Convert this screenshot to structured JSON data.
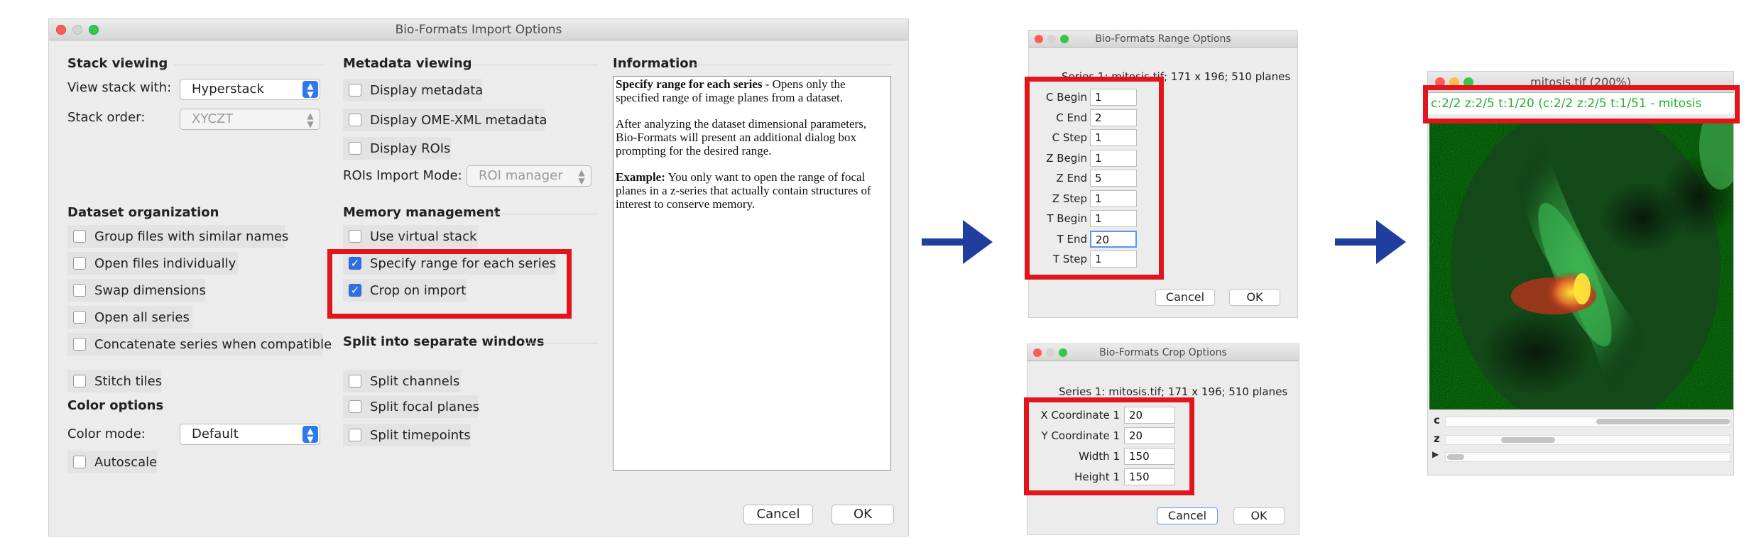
{
  "import_dialog": {
    "title": "Bio-Formats Import Options",
    "stack_viewing": {
      "heading": "Stack viewing",
      "view_stack_label": "View stack with:",
      "view_stack_value": "Hyperstack",
      "stack_order_label": "Stack order:",
      "stack_order_value": "XYCZT"
    },
    "dataset_org": {
      "heading": "Dataset organization",
      "items": [
        {
          "label": "Group files with similar names",
          "checked": false
        },
        {
          "label": "Open files individually",
          "checked": false
        },
        {
          "label": "Swap dimensions",
          "checked": false
        },
        {
          "label": "Open all series",
          "checked": false
        },
        {
          "label": "Concatenate series when compatible",
          "checked": false
        },
        {
          "label": "Stitch tiles",
          "checked": false
        }
      ]
    },
    "color_options": {
      "heading": "Color options",
      "color_mode_label": "Color mode:",
      "color_mode_value": "Default",
      "autoscale_label": "Autoscale"
    },
    "metadata_viewing": {
      "heading": "Metadata viewing",
      "items": [
        {
          "label": "Display metadata",
          "checked": false
        },
        {
          "label": "Display OME-XML metadata",
          "checked": false
        },
        {
          "label": "Display ROIs",
          "checked": false
        }
      ],
      "rois_mode_label": "ROIs Import Mode:",
      "rois_mode_value": "ROI manager"
    },
    "memory_management": {
      "heading": "Memory management",
      "items": [
        {
          "label": "Use virtual stack",
          "checked": false
        },
        {
          "label": "Specify range for each series",
          "checked": true
        },
        {
          "label": "Crop on import",
          "checked": true
        }
      ]
    },
    "split": {
      "heading": "Split into separate windows",
      "items": [
        {
          "label": "Split channels",
          "checked": false
        },
        {
          "label": "Split focal planes",
          "checked": false
        },
        {
          "label": "Split timepoints",
          "checked": false
        }
      ]
    },
    "information": {
      "heading": "Information",
      "p1_bold": "Specify range for each series",
      "p1_rest": " - Opens only the specified range of image planes from a dataset.",
      "p2": "After analyzing the dataset dimensional parameters, Bio-Formats will present an additional dialog box prompting for the desired range.",
      "p3_bold": "Example:",
      "p3_rest": " You only want to open the range of focal planes in a z-series that actually contain structures of interest to conserve memory."
    },
    "cancel_label": "Cancel",
    "ok_label": "OK"
  },
  "range_dialog": {
    "title": "Bio-Formats Range Options",
    "series_info": "Series 1: mitosis.tif; 171 x 196; 510 planes",
    "fields": [
      {
        "label": "C Begin",
        "value": "1"
      },
      {
        "label": "C End",
        "value": "2"
      },
      {
        "label": "C Step",
        "value": "1"
      },
      {
        "label": "Z Begin",
        "value": "1"
      },
      {
        "label": "Z End",
        "value": "5"
      },
      {
        "label": "Z Step",
        "value": "1"
      },
      {
        "label": "T Begin",
        "value": "1"
      },
      {
        "label": "T End",
        "value": "20"
      },
      {
        "label": "T Step",
        "value": "1"
      }
    ],
    "cancel_label": "Cancel",
    "ok_label": "OK"
  },
  "crop_dialog": {
    "title": "Bio-Formats Crop Options",
    "series_info": "Series 1: mitosis.tif; 171 x 196; 510 planes",
    "fields": [
      {
        "label": "X Coordinate 1",
        "value": "20"
      },
      {
        "label": "Y Coordinate 1",
        "value": "20"
      },
      {
        "label": "Width 1",
        "value": "150"
      },
      {
        "label": "Height 1",
        "value": "150"
      }
    ],
    "cancel_label": "Cancel",
    "ok_label": "OK"
  },
  "image_window": {
    "title": "mitosis.tif (200%)",
    "overlay_text": "c:2/2 z:2/5 t:1/20 (c:2/2 z:2/5 t:1/51 - mitosis",
    "slider_c_label": "c",
    "slider_z_label": "z"
  },
  "colors": {
    "accent_blue": "#2f6fe6",
    "highlight_red": "#e1151b",
    "arrow_blue": "#1f3e9e",
    "overlay_green": "#1fb12b"
  }
}
